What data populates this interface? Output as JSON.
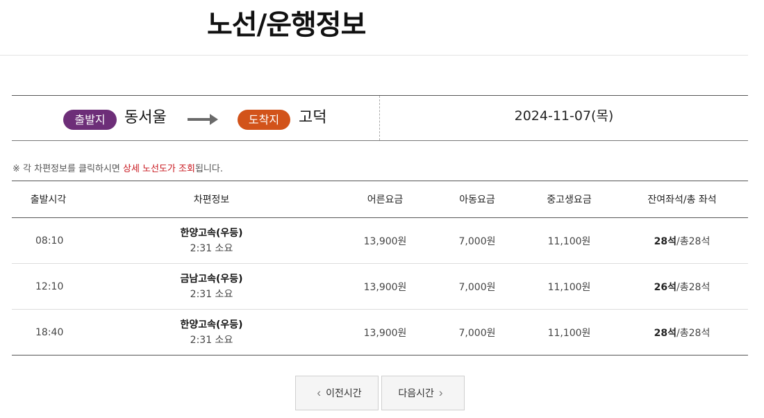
{
  "page_title": "노선/운행정보",
  "route": {
    "departure_badge": "출발지",
    "departure_city": "동서울",
    "arrival_badge": "도착지",
    "arrival_city": "고덕",
    "date": "2024-11-07(목)",
    "colors": {
      "departure_badge": "#6d2e78",
      "arrival_badge": "#d2531a",
      "arrow": "#6a6a6a"
    }
  },
  "notice": {
    "prefix": "※ 각 차편정보를 클릭하시면 ",
    "highlight": "상세 노선도가 조회",
    "suffix": "됩니다.",
    "highlight_color": "#c8161d"
  },
  "table": {
    "headers": [
      "출발시각",
      "차편정보",
      "어른요금",
      "아동요금",
      "중고생요금",
      "잔여좌석/총 좌석"
    ],
    "rows": [
      {
        "time": "08:10",
        "carrier": "한양고속(우등)",
        "duration": "2:31 소요",
        "adult_fare": "13,900원",
        "child_fare": "7,000원",
        "student_fare": "11,100원",
        "seats_left": "28석",
        "seats_total": "/총28석"
      },
      {
        "time": "12:10",
        "carrier": "금남고속(우등)",
        "duration": "2:31 소요",
        "adult_fare": "13,900원",
        "child_fare": "7,000원",
        "student_fare": "11,100원",
        "seats_left": "26석",
        "seats_total": "/총28석"
      },
      {
        "time": "18:40",
        "carrier": "한양고속(우등)",
        "duration": "2:31 소요",
        "adult_fare": "13,900원",
        "child_fare": "7,000원",
        "student_fare": "11,100원",
        "seats_left": "28석",
        "seats_total": "/총28석"
      }
    ]
  },
  "pagination": {
    "prev_label": "이전시간",
    "next_label": "다음시간",
    "prev_icon": "chevron-left-icon",
    "next_icon": "chevron-right-icon"
  }
}
